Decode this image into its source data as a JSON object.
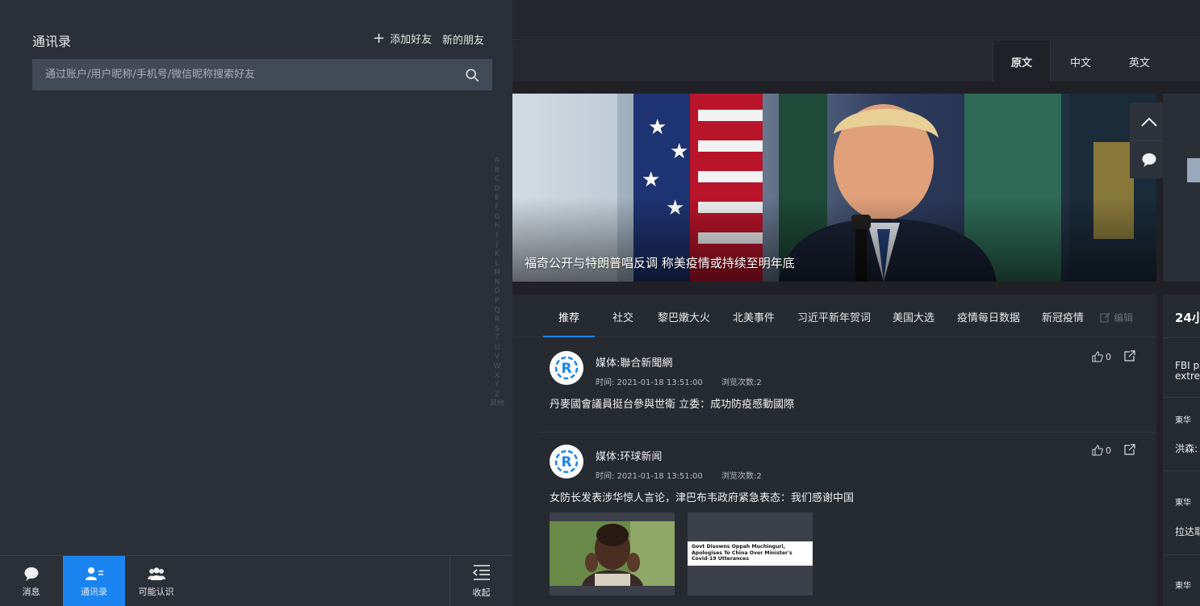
{
  "contacts": {
    "title": "通讯录",
    "add_friend": "添加好友",
    "new_friends": "新的朋友",
    "search_placeholder": "通过账户/用户昵称/手机号/微信昵称搜索好友",
    "alphabet": [
      "A",
      "B",
      "C",
      "D",
      "E",
      "F",
      "G",
      "H",
      "I",
      "J",
      "K",
      "L",
      "M",
      "N",
      "O",
      "P",
      "Q",
      "R",
      "S",
      "T",
      "U",
      "V",
      "W",
      "X",
      "Y",
      "Z",
      "其他"
    ]
  },
  "bottom_nav": {
    "messages": "消息",
    "contacts": "通讯录",
    "maybe_know": "可能认识",
    "collapse": "收起"
  },
  "language": {
    "original": "原文",
    "chinese": "中文",
    "english": "英文"
  },
  "hero": {
    "caption": "福奇公开与特朗普唱反调 称美疫情或持续至明年底"
  },
  "tabs": [
    "推荐",
    "社交",
    "黎巴嫩大火",
    "北美事件",
    "习近平新年贺词",
    "美国大选",
    "疫情每日数据",
    "新冠疫情"
  ],
  "edit_label": "编辑",
  "posts": [
    {
      "media": "媒体:聯合新聞網",
      "time": "时间: 2021-01-18 13:51:00",
      "views": "浏览次数:2",
      "title": "丹麥國會議員挺台參與世衛 立委：成功防疫感動國際",
      "likes": "0"
    },
    {
      "media": "媒体:环球新闻",
      "time": "时间: 2021-01-18 13:51:00",
      "views": "浏览次数:2",
      "title": "女防长发表涉华惊人言论，津巴布韦政府紧急表态：我们感谢中国",
      "likes": "0",
      "thumb2_headline": "Govt Disowns Oppah Muchinguri, Apologises To China Over Minister's Covid-19 Utterances"
    }
  ],
  "side_panel": {
    "title": "24小",
    "snippet1": "FBI p",
    "snippet1b": "extrem",
    "source": "東华",
    "snippet2": "洪森:",
    "snippet3": "拉达耶"
  },
  "colors": {
    "accent": "#1a85f0",
    "panel": "#2b2f38",
    "background": "#1f2126"
  }
}
